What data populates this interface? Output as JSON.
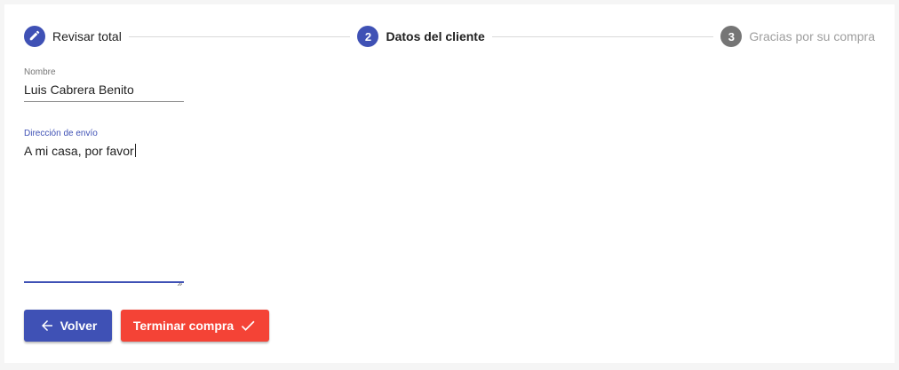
{
  "colors": {
    "primary": "#3f51b5",
    "warn": "#f44336",
    "pending": "#757575"
  },
  "stepper": {
    "steps": [
      {
        "index": "1",
        "label": "Revisar total",
        "state": "done",
        "icon": "pencil-icon"
      },
      {
        "index": "2",
        "label": "Datos del cliente",
        "state": "active"
      },
      {
        "index": "3",
        "label": "Gracias por su compra",
        "state": "pending"
      }
    ]
  },
  "form": {
    "name": {
      "label": "Nombre",
      "value": "Luis Cabrera Benito"
    },
    "address": {
      "label": "Dirección de envío",
      "value": "A mi casa, por favor"
    }
  },
  "actions": {
    "back_label": "Volver",
    "back_icon": "arrow-left-icon",
    "finish_label": "Terminar compra",
    "finish_icon": "check-icon"
  }
}
